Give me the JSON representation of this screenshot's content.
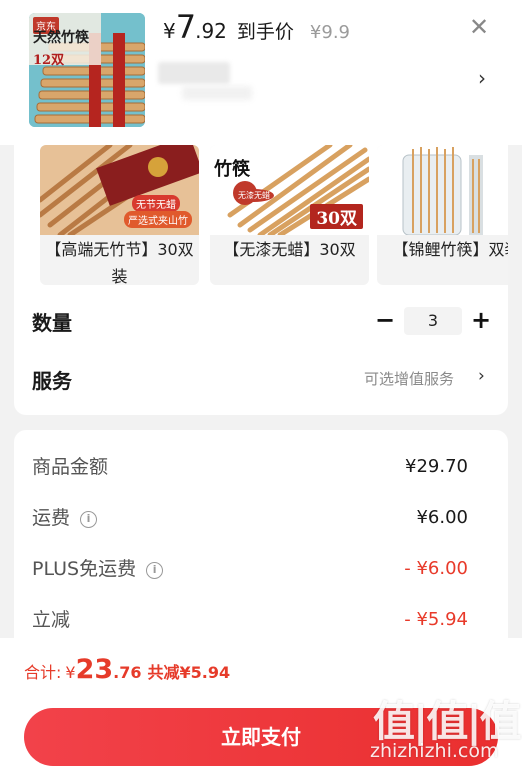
{
  "product": {
    "thumb_badge": "京东",
    "thumb_title": "天然竹筷",
    "thumb_count": "12双",
    "currency": "¥",
    "price_int": "7",
    "price_dec": ".92",
    "price_label": "到手价",
    "original_price": "¥9.9"
  },
  "variants": [
    {
      "label": "【高端无竹节】30双装",
      "tags": [
        "无节无蜡",
        "严选式夹山竹"
      ]
    },
    {
      "label": "【无漆无蜡】30双",
      "side_text": "竹筷",
      "seal": "无漆无蜡",
      "count_badge": "30双"
    },
    {
      "label": "【锦鲤竹筷】双装"
    }
  ],
  "quantity": {
    "label": "数量",
    "value": "3",
    "minus": "−",
    "plus": "+"
  },
  "service": {
    "label": "服务",
    "value": "可选增值服务"
  },
  "amounts": [
    {
      "label": "商品金额",
      "value": "¥29.70",
      "info": false,
      "red": false
    },
    {
      "label": "运费",
      "value": "¥6.00",
      "info": true,
      "red": false
    },
    {
      "label": "PLUS免运费",
      "value": "- ¥6.00",
      "info": true,
      "red": true
    },
    {
      "label": "立减",
      "value": "- ¥5.94",
      "info": false,
      "red": true
    }
  ],
  "footer": {
    "total_label": "合计:",
    "total_yen": "¥",
    "total_int": "23",
    "total_dec": ".76",
    "saved": "共减¥5.94",
    "pay_button": "立即支付"
  },
  "watermark": {
    "logo": "值|值|值",
    "text": "zhizhizhi.com"
  },
  "colors": {
    "accent_red": "#e63b2a",
    "button_red": "#ee3a3f",
    "card_bg": "#ffffff",
    "page_bg": "#f2f2f2"
  }
}
